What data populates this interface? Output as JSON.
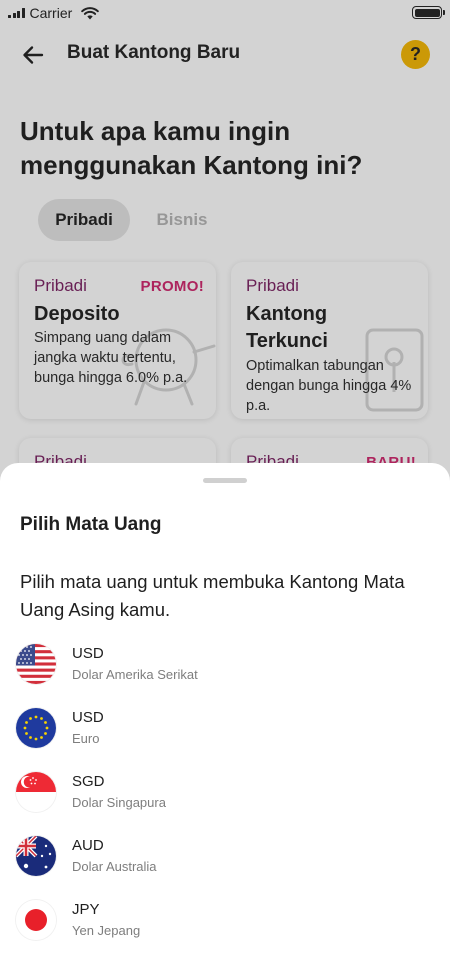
{
  "status_bar": {
    "carrier": "Carrier"
  },
  "header": {
    "title": "Buat Kantong Baru",
    "help_label": "?"
  },
  "question": "Untuk apa kamu ingin menggunakan Kantong ini?",
  "tabs": [
    {
      "label": "Pribadi",
      "selected": true
    },
    {
      "label": "Bisnis",
      "selected": false
    }
  ],
  "cards": [
    {
      "category": "Pribadi",
      "badge": "PROMO!",
      "title": "Deposito",
      "description": "Simpang uang dalam jangka waktu tertentu, bunga hingga 6.0% p.a."
    },
    {
      "category": "Pribadi",
      "badge": "",
      "title": "Kantong Terkunci",
      "description": "Optimalkan tabungan dengan bunga hingga 4% p.a."
    },
    {
      "category": "Pribadi",
      "badge": "",
      "title": "",
      "description": ""
    },
    {
      "category": "Pribadi",
      "badge": "BARU!",
      "title": "",
      "description": ""
    }
  ],
  "sheet": {
    "title": "Pilih Mata Uang",
    "description": "Pilih mata uang untuk membuka Kantong Mata Uang Asing kamu.",
    "currencies": [
      {
        "code": "USD",
        "name": "Dolar Amerika Serikat",
        "flag": "us-flag-icon"
      },
      {
        "code": "USD",
        "name": "Euro",
        "flag": "eu-flag-icon"
      },
      {
        "code": "SGD",
        "name": "Dolar Singapura",
        "flag": "sg-flag-icon"
      },
      {
        "code": "AUD",
        "name": "Dolar Australia",
        "flag": "au-flag-icon"
      },
      {
        "code": "JPY",
        "name": "Yen Jepang",
        "flag": "jp-flag-icon"
      }
    ]
  },
  "colors": {
    "help_button": "#f5b700",
    "category_text": "#7a1e61",
    "badge_text": "#d0256c"
  }
}
